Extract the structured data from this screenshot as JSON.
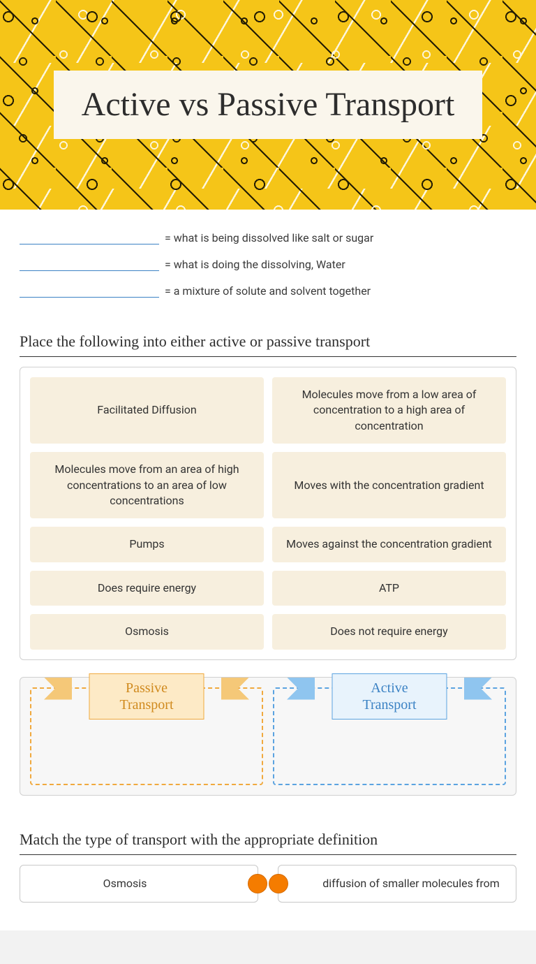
{
  "title": "Active vs Passive Transport",
  "definitions": [
    "= what is being dissolved like salt or sugar",
    "= what is doing the dissolving, Water",
    "= a mixture of solute and solvent together"
  ],
  "sort_heading": "Place the following into either active or passive transport",
  "cards": [
    "Facilitated Diffusion",
    "Molecules move from a low area of concentration to a high area of concentration",
    "Molecules move from an area of high concentrations to an area of low concentrations",
    "Moves with the concentration gradient",
    "Pumps",
    "Moves against the concentration gradient",
    "Does require energy",
    "ATP",
    "Osmosis",
    "Does not require energy"
  ],
  "zones": {
    "passive": "Passive Transport",
    "active": "Active Transport"
  },
  "match_heading": "Match the type of transport with the appropriate definition",
  "match_left": [
    "Osmosis"
  ],
  "match_right": [
    "diffusion of smaller molecules from"
  ]
}
